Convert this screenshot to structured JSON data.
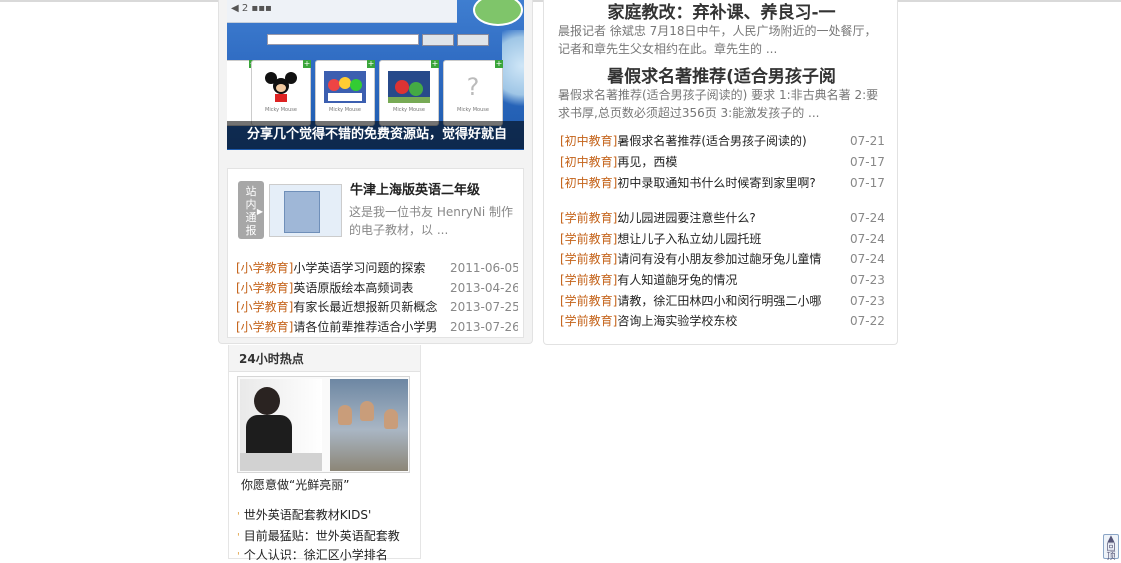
{
  "banner": {
    "caption": "分享几个觉得不错的免费资源站，觉得好就自",
    "cards": [
      {
        "label": "Micky Mouse",
        "icon": "mickey-mouse-icon"
      },
      {
        "label": "Micky Mouse",
        "icon": "cartoon-group-icon"
      },
      {
        "label": "Micky Mouse",
        "icon": "cartoon-scene-icon"
      },
      {
        "label": "Micky Mouse",
        "icon": "question-mark-icon"
      }
    ]
  },
  "station_notice": {
    "badge": "站内通报",
    "title": "牛津上海版英语二年级",
    "desc": "这是我一位书友 HenryNi 制作的电子教材，以 ..."
  },
  "left_list": [
    {
      "cat": "[小学教育]",
      "title": "小学英语学习问题的探索",
      "date": "2011-06-05"
    },
    {
      "cat": "[小学教育]",
      "title": "英语原版绘本高频词表",
      "date": "2013-04-26"
    },
    {
      "cat": "[小学教育]",
      "title": "有家长最近想报新贝新概念",
      "date": "2013-07-25"
    },
    {
      "cat": "[小学教育]",
      "title": "请各位前辈推荐适合小学男",
      "date": "2013-07-26"
    }
  ],
  "right_heads": [
    {
      "title": "家庭教改：弃补课、养良习-一",
      "desc": "晨报记者 徐斌忠 7月18日中午，人民广场附近的一处餐厅，记者和章先生父女相约在此。章先生的 ..."
    },
    {
      "title": "暑假求名著推荐(适合男孩子阅",
      "desc": "暑假求名著推荐(适合男孩子阅读的) 要求 1:非古典名著 2:要求书厚,总页数必须超过356页 3:能激发孩子的 ..."
    }
  ],
  "junior_list": [
    {
      "cat": "[初中教育]",
      "title": "暑假求名著推荐(适合男孩子阅读的)",
      "date": "07-21"
    },
    {
      "cat": "[初中教育]",
      "title": "再见，西模",
      "date": "07-17"
    },
    {
      "cat": "[初中教育]",
      "title": "初中录取通知书什么时候寄到家里啊?",
      "date": "07-17"
    }
  ],
  "preschool_list": [
    {
      "cat": "[学前教育]",
      "title": "幼儿园进园要注意些什么?",
      "date": "07-24"
    },
    {
      "cat": "[学前教育]",
      "title": "想让儿子入私立幼儿园托班",
      "date": "07-24"
    },
    {
      "cat": "[学前教育]",
      "title": "请问有没有小朋友参加过龅牙兔儿童情",
      "date": "07-24"
    },
    {
      "cat": "[学前教育]",
      "title": "有人知道龅牙兔的情况",
      "date": "07-23"
    },
    {
      "cat": "[学前教育]",
      "title": "请教，徐汇田林四小和闵行明强二小哪",
      "date": "07-23"
    },
    {
      "cat": "[学前教育]",
      "title": "咨询上海实验学校东校",
      "date": "07-22"
    }
  ],
  "hot": {
    "title": "24小时热点",
    "caption": "你愿意做“光鲜亮丽”",
    "links": [
      "世外英语配套教材KIDS'",
      "目前最猛贴：世外英语配套教",
      "个人认识：徐汇区小学排名"
    ]
  },
  "back_to_top": "回顶"
}
